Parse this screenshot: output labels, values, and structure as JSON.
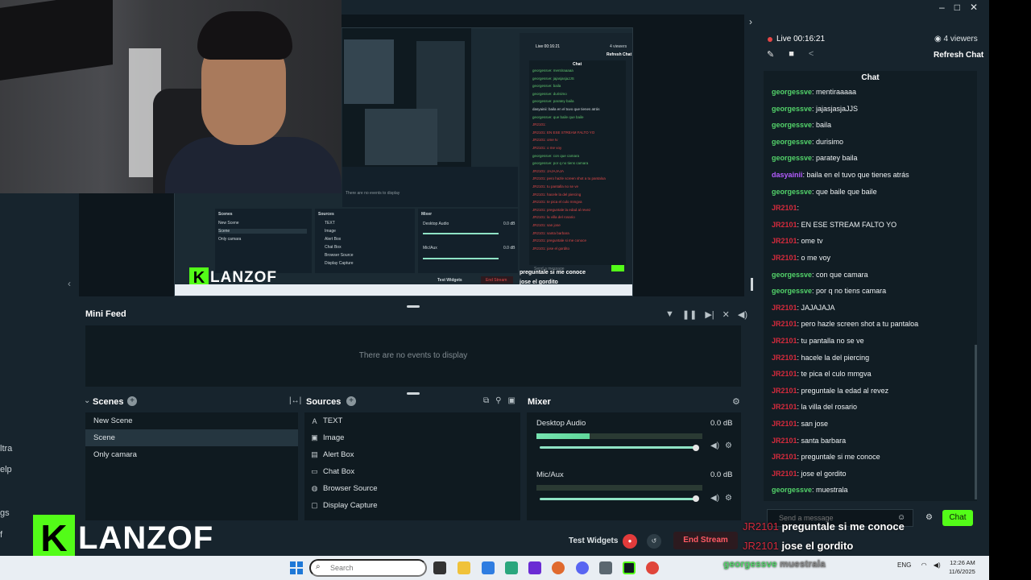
{
  "left_strip": {
    "items": [
      "ltra",
      "elp",
      "gs",
      "f"
    ]
  },
  "preview": {
    "capture_texts": {
      "live": "Live 00:16:21",
      "viewers": "4 viewers",
      "refresh": "Refresh Chat",
      "chat": "Chat",
      "empty": "There are no events to display",
      "scenes": "Scenes",
      "sources": "Sources",
      "mixer": "Mixer",
      "scene_items": [
        "New Scene",
        "Scene",
        "Only camara"
      ],
      "source_items": [
        "TEXT",
        "Image",
        "Alert Box",
        "Chat Box",
        "Browser Source",
        "Display Capture"
      ],
      "mixer_items": [
        "Desktop Audio",
        "Mic/Aux"
      ],
      "db": "0.0 dB",
      "test_widgets": "Test Widgets",
      "end_stream": "End Stream",
      "send": "Send a message",
      "chat_btn": "Chat",
      "overlay1": "preguntale si me conoce",
      "overlay2": "jose el gordito"
    }
  },
  "logo": {
    "k": "K",
    "text": "LANZOF"
  },
  "minifeed": {
    "title": "Mini Feed",
    "empty": "There are no events to display"
  },
  "scenes": {
    "title": "Scenes",
    "items": [
      "New Scene",
      "Scene",
      "Only camara"
    ],
    "selected": "Scene"
  },
  "sources": {
    "title": "Sources",
    "items": [
      "TEXT",
      "Image",
      "Alert Box",
      "Chat Box",
      "Browser Source",
      "Display Capture"
    ]
  },
  "mixer": {
    "title": "Mixer",
    "channels": [
      {
        "name": "Desktop Audio",
        "db": "0.0 dB",
        "level": 0.32
      },
      {
        "name": "Mic/Aux",
        "db": "0.0 dB",
        "level": 0.0
      }
    ]
  },
  "bottom": {
    "test_widgets": "Test Widgets",
    "end_stream": "End Stream"
  },
  "live": {
    "status": "Live 00:16:21",
    "viewers": "4 viewers",
    "refresh": "Refresh Chat"
  },
  "chat": {
    "title": "Chat",
    "placeholder": "Send a message",
    "button": "Chat",
    "messages": [
      {
        "user": "georgessve",
        "color": "green",
        "text": ": mentiraaaaa"
      },
      {
        "user": "georgessve",
        "color": "green",
        "text": ": jajasjasjaJJS"
      },
      {
        "user": "georgessve",
        "color": "green",
        "text": ": baila"
      },
      {
        "user": "georgessve",
        "color": "green",
        "text": ": durisimo"
      },
      {
        "user": "georgessve",
        "color": "green",
        "text": ": paratey baila"
      },
      {
        "user": "dasyainii",
        "color": "purple",
        "text": ": baila en el tuvo que tienes atrás"
      },
      {
        "user": "georgessve",
        "color": "green",
        "text": ": que baile que baile"
      },
      {
        "user": "JR2101",
        "color": "red",
        "text": ":"
      },
      {
        "user": "JR2101",
        "color": "red",
        "text": ": EN ESE STREAM FALTO YO"
      },
      {
        "user": "JR2101",
        "color": "red",
        "text": ": ome tv"
      },
      {
        "user": "JR2101",
        "color": "red",
        "text": ": o me voy"
      },
      {
        "user": "georgessve",
        "color": "green",
        "text": ": con que camara"
      },
      {
        "user": "georgessve",
        "color": "green",
        "text": ": por q no tiens camara"
      },
      {
        "user": "JR2101",
        "color": "red",
        "text": ": JAJAJAJA"
      },
      {
        "user": "JR2101",
        "color": "red",
        "text": ": pero hazle screen shot a tu pantaloa"
      },
      {
        "user": "JR2101",
        "color": "red",
        "text": ": tu pantalla no se ve"
      },
      {
        "user": "JR2101",
        "color": "red",
        "text": ": hacele la del piercing"
      },
      {
        "user": "JR2101",
        "color": "red",
        "text": ": te pica el culo mmgva"
      },
      {
        "user": "JR2101",
        "color": "red",
        "text": ": preguntale la edad al revez"
      },
      {
        "user": "JR2101",
        "color": "red",
        "text": ": la villa del rosario"
      },
      {
        "user": "JR2101",
        "color": "red",
        "text": ": san jose"
      },
      {
        "user": "JR2101",
        "color": "red",
        "text": ": santa barbara"
      },
      {
        "user": "JR2101",
        "color": "red",
        "text": ": preguntale si me conoce"
      },
      {
        "user": "JR2101",
        "color": "red",
        "text": ": jose el gordito"
      },
      {
        "user": "georgessve",
        "color": "green",
        "text": ": muestrala"
      }
    ]
  },
  "overlays": [
    {
      "user": "JR2101",
      "text": "preguntale si me conoce"
    },
    {
      "user": "JR2101",
      "text": "jose el gordito"
    },
    {
      "user": "georgessve",
      "text": "muestrala"
    }
  ],
  "taskbar": {
    "search": "Search",
    "lang": "ENG",
    "time": "12:26 AM",
    "date": "11/6/2025"
  }
}
